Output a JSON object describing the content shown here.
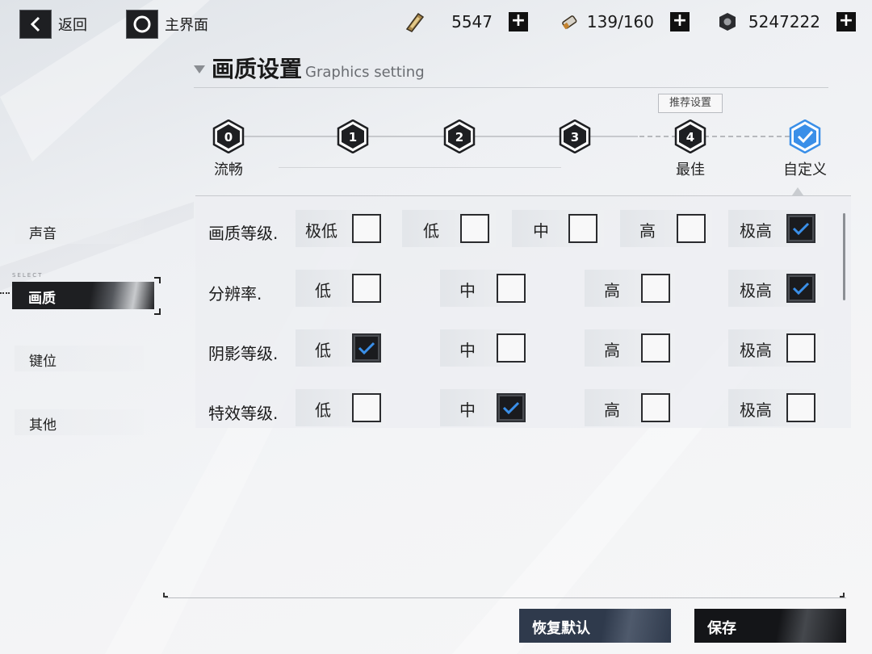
{
  "topbar": {
    "back_label": "返回",
    "home_label": "主界面",
    "resources": [
      {
        "icon": "energy-battery-icon",
        "value": "5547"
      },
      {
        "icon": "ammo-cartridge-icon",
        "value": "139/160"
      },
      {
        "icon": "hex-nut-icon",
        "value": "5247222"
      }
    ]
  },
  "section": {
    "title_cn": "画质设置",
    "title_en": "Graphics setting"
  },
  "presets": {
    "recommend_tag": "推荐设置",
    "items": [
      {
        "num": "0",
        "label": "流畅"
      },
      {
        "num": "1",
        "label": ""
      },
      {
        "num": "2",
        "label": ""
      },
      {
        "num": "3",
        "label": ""
      },
      {
        "num": "4",
        "label": "最佳"
      },
      {
        "num": "",
        "label": "自定义",
        "selected": true
      }
    ]
  },
  "menu": {
    "select_tag": "SELECT",
    "items": [
      {
        "label": "声音"
      },
      {
        "label": "画质",
        "active": true
      },
      {
        "label": "键位"
      },
      {
        "label": "其他"
      }
    ]
  },
  "settings": {
    "rows": [
      {
        "label": "画质等级.",
        "options": [
          {
            "text": "极低",
            "checked": false
          },
          {
            "text": "低",
            "checked": false
          },
          {
            "text": "中",
            "checked": false
          },
          {
            "text": "高",
            "checked": false
          },
          {
            "text": "极高",
            "checked": true
          }
        ]
      },
      {
        "label": "分辨率.",
        "options": [
          {
            "text": "低",
            "checked": false
          },
          {
            "text": "中",
            "checked": false
          },
          {
            "text": "高",
            "checked": false
          },
          {
            "text": "极高",
            "checked": true
          }
        ]
      },
      {
        "label": "阴影等级.",
        "options": [
          {
            "text": "低",
            "checked": true
          },
          {
            "text": "中",
            "checked": false
          },
          {
            "text": "高",
            "checked": false
          },
          {
            "text": "极高",
            "checked": false
          }
        ]
      },
      {
        "label": "特效等级.",
        "options": [
          {
            "text": "低",
            "checked": false
          },
          {
            "text": "中",
            "checked": true
          },
          {
            "text": "高",
            "checked": false
          },
          {
            "text": "极高",
            "checked": false
          }
        ]
      }
    ]
  },
  "buttons": {
    "reset_label": "恢复默认",
    "save_label": "保存"
  },
  "colors": {
    "accent_blue": "#3a8fe8",
    "dark": "#1e1f22",
    "reset_button": "#2f3a4c"
  }
}
